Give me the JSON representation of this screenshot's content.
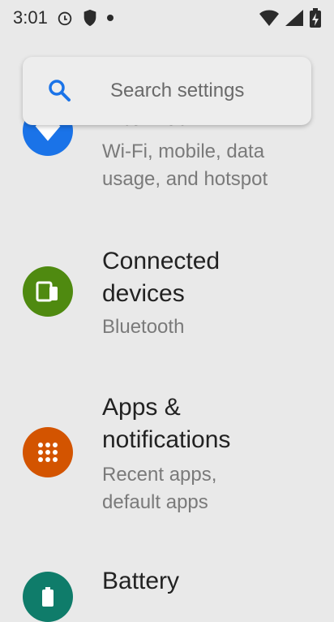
{
  "status_bar": {
    "time": "3:01",
    "icons": [
      "alarm-icon",
      "shield-icon",
      "dot-icon",
      "wifi-icon",
      "signal-icon",
      "battery-charging-icon"
    ]
  },
  "search": {
    "placeholder": "Search settings"
  },
  "settings": [
    {
      "title": "Internet",
      "subtitle": "Wi-Fi, mobile, data usage, and hotspot",
      "icon": "wifi-icon",
      "icon_color": "#1a73e8"
    },
    {
      "title": "Connected devices",
      "subtitle": "Bluetooth",
      "icon": "devices-icon",
      "icon_color": "#4f8a10"
    },
    {
      "title": "Apps & notifications",
      "subtitle": "Recent apps, default apps",
      "icon": "apps-grid-icon",
      "icon_color": "#d35400"
    },
    {
      "title": "Battery",
      "subtitle": "",
      "icon": "battery-icon",
      "icon_color": "#0f7c6a"
    }
  ],
  "colors": {
    "background": "#e9e9e9",
    "search_bg": "#ededed",
    "accent_blue": "#1a73e8"
  }
}
